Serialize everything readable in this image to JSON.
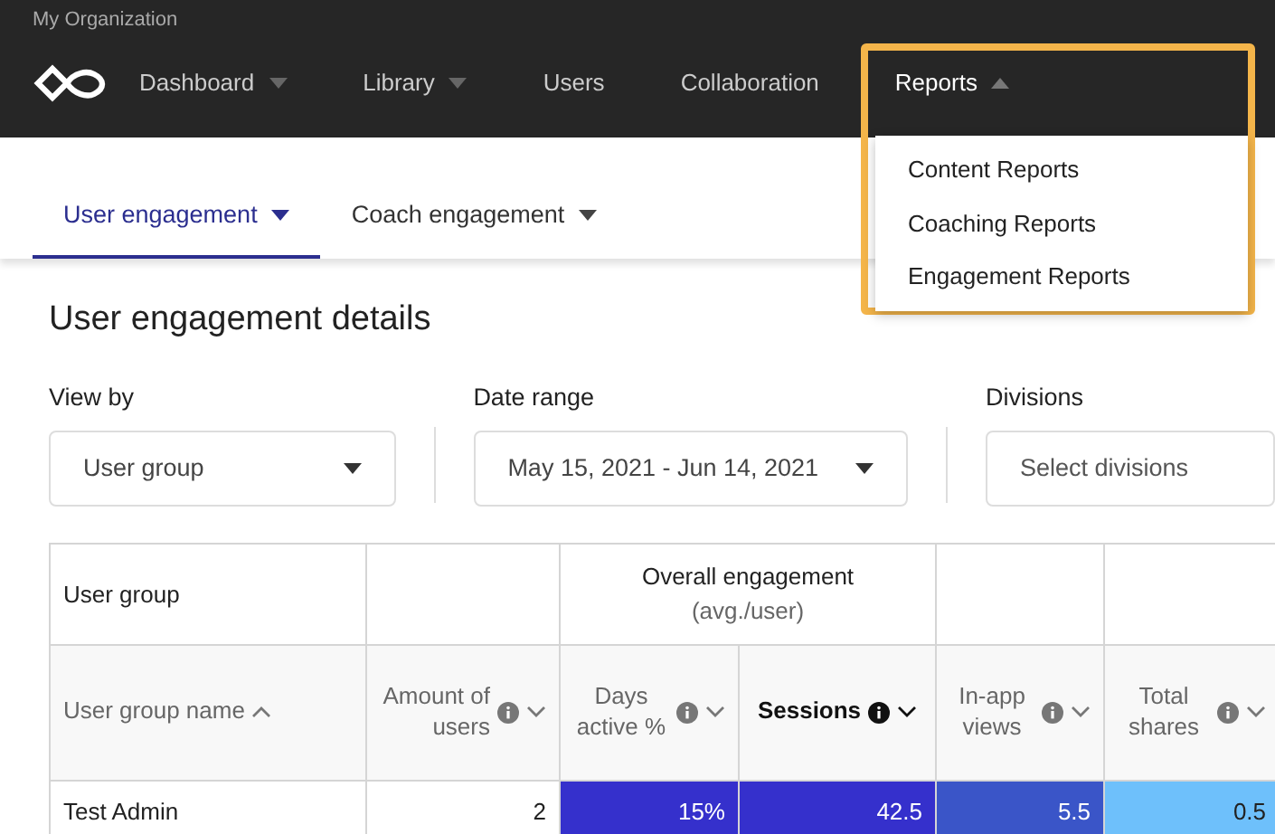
{
  "organization": "My Organization",
  "nav": [
    {
      "label": "Dashboard",
      "dropdown": true,
      "expanded": false,
      "selected": false
    },
    {
      "label": "Library",
      "dropdown": true,
      "expanded": false,
      "selected": false
    },
    {
      "label": "Users",
      "dropdown": false,
      "selected": false
    },
    {
      "label": "Collaboration",
      "dropdown": false,
      "selected": false
    },
    {
      "label": "Reports",
      "dropdown": true,
      "expanded": true,
      "selected": true
    }
  ],
  "reports_menu": [
    "Content Reports",
    "Coaching Reports",
    "Engagement Reports"
  ],
  "tabs": [
    {
      "label": "User engagement",
      "selected": true
    },
    {
      "label": "Coach engagement",
      "selected": false
    }
  ],
  "title": "User engagement details",
  "filters": [
    {
      "label": "View by",
      "value": "User group",
      "kind": "select"
    },
    {
      "label": "Date range",
      "value": "May 15, 2021 - Jun 14, 2021",
      "kind": "select"
    },
    {
      "label": "Divisions",
      "placeholder": "Select divisions",
      "kind": "placeholder"
    }
  ],
  "table": {
    "group_headers": [
      {
        "kind": "single",
        "label": "User group"
      },
      {
        "kind": "empty"
      },
      {
        "kind": "pair",
        "label": "Overall engagement",
        "subtitle": "(avg./user)"
      },
      {
        "kind": "empty"
      },
      {
        "kind": "empty"
      }
    ],
    "columns": [
      {
        "label": "User group name",
        "info": false,
        "sort_ascending": true,
        "active": false
      },
      {
        "label": "Amount of users",
        "info": true,
        "sort_ascending": false,
        "active": false
      },
      {
        "label": "Days active %",
        "info": true,
        "sort_ascending": false,
        "active": false
      },
      {
        "label": "Sessions",
        "info": true,
        "sort_ascending": false,
        "active": true
      },
      {
        "label": "In-app views",
        "info": true,
        "sort_ascending": false,
        "active": false
      },
      {
        "label": "Total shares",
        "info": true,
        "sort_ascending": false,
        "active": false
      }
    ],
    "rows": [
      {
        "cells": [
          {
            "text": "Test Admin"
          },
          {
            "text": "2"
          },
          {
            "text": "15%",
            "color": "#3530cc"
          },
          {
            "text": "42.5",
            "color": "#3530cc"
          },
          {
            "text": "5.5",
            "color": "#3a55c8"
          },
          {
            "text": "0.5",
            "color": "#6ec0fb"
          }
        ]
      }
    ]
  }
}
